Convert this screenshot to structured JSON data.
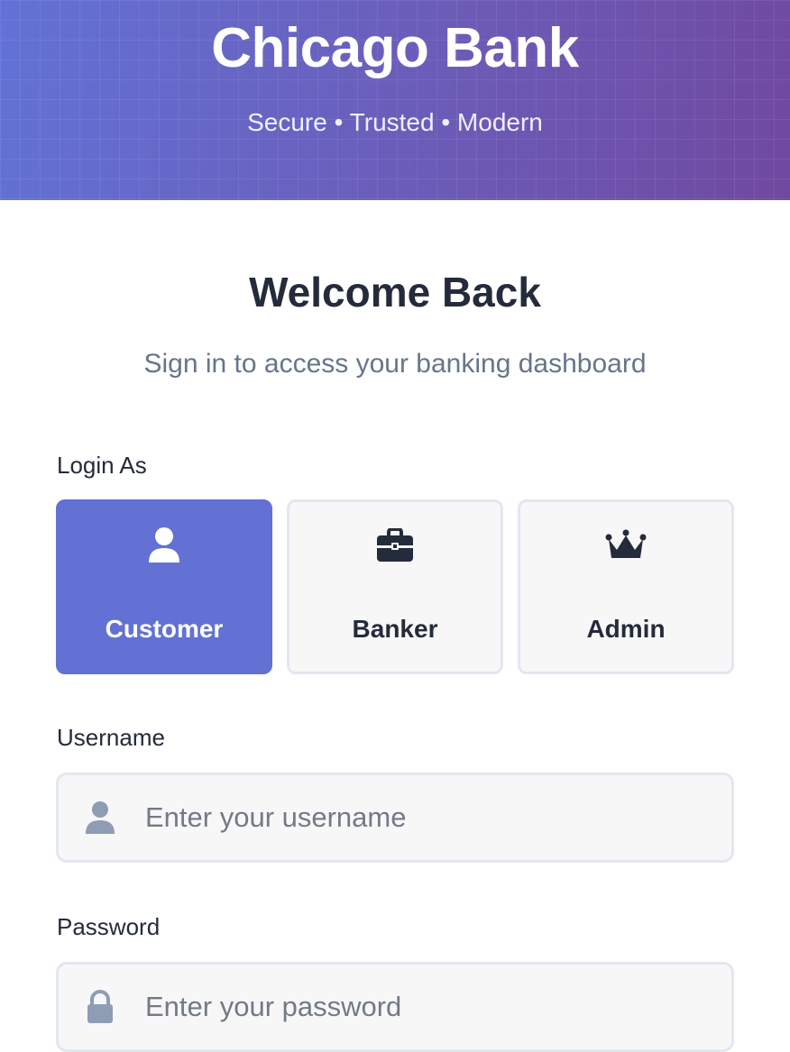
{
  "header": {
    "title": "Chicago Bank",
    "tagline": "Secure • Trusted • Modern"
  },
  "welcome": {
    "title": "Welcome Back",
    "subtitle": "Sign in to access your banking dashboard"
  },
  "login_as": {
    "label": "Login As",
    "selected": "Customer",
    "options": [
      {
        "label": "Customer",
        "icon": "user-icon"
      },
      {
        "label": "Banker",
        "icon": "briefcase-icon"
      },
      {
        "label": "Admin",
        "icon": "crown-icon"
      }
    ]
  },
  "username": {
    "label": "Username",
    "placeholder": "Enter your username",
    "value": "",
    "icon": "user-icon"
  },
  "password": {
    "label": "Password",
    "placeholder": "Enter your password",
    "value": "",
    "icon": "lock-icon"
  },
  "colors": {
    "accent": "#6271d3",
    "header_gradient_start": "#6272d6",
    "header_gradient_end": "#7049a0",
    "text_dark": "#242b3a",
    "text_muted": "#66758a",
    "field_background": "#f7f7f8",
    "field_border": "#e2e7ef"
  }
}
